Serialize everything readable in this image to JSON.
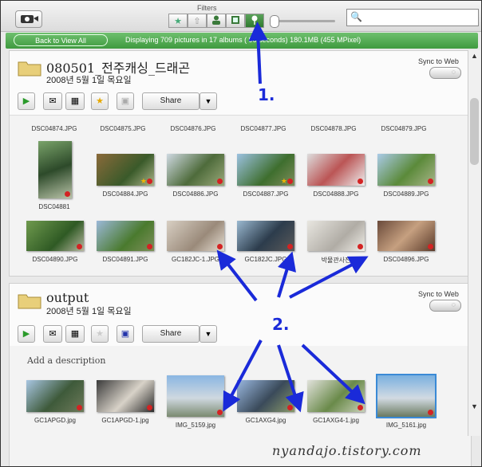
{
  "toolbar": {
    "filters_label": "Filters",
    "filter_buttons": [
      "★",
      "⇧",
      "👤",
      "▤",
      "📍"
    ],
    "search_placeholder": ""
  },
  "statusbar": {
    "back_label": "Back to View All",
    "status_text": "Displaying 709 pictures in 17 albums (  90 seconds) 180.1MB (455 MPixel)"
  },
  "albums": [
    {
      "title": "080501_전주캐싱_드래곤",
      "date": "2008년 5월 1일 목요일",
      "sync_label": "Sync to Web",
      "share_label": "Share",
      "rows": [
        [
          "DSC04874.JPG",
          "DSC04875.JPG",
          "DSC04876.JPG",
          "DSC04877.JPG",
          "DSC04878.JPG",
          "DSC04879.JPG"
        ],
        [
          "DSC04881",
          "DSC04884.JPG",
          "DSC04886.JPG",
          "DSC04887.JPG",
          "DSC04888.JPG",
          "DSC04889.JPG"
        ],
        [
          "DSC04890.JPG",
          "DSC04891.JPG",
          "GC182JC-1.JPG",
          "GC182JC.JPG",
          "박물관사진",
          "DSC04896.JPG"
        ]
      ]
    },
    {
      "title": "output",
      "date": "2008년 5월 1일 목요일",
      "sync_label": "Sync to Web",
      "share_label": "Share",
      "description_placeholder": "Add a description",
      "rows": [
        [
          "GC1APGD.jpg",
          "GC1APGD-1.jpg",
          "IMG_5159.jpg",
          "GC1AXG4.jpg",
          "GC1AXG4-1.jpg",
          "IMG_5161.jpg"
        ]
      ]
    }
  ],
  "annotations": {
    "one": "1.",
    "two": "2."
  },
  "watermark": "nyandajo.tistory.com",
  "colors": {
    "status_green": "#4aa84a",
    "arrow_blue": "#1a2ad9",
    "pin_red": "#d32323"
  }
}
